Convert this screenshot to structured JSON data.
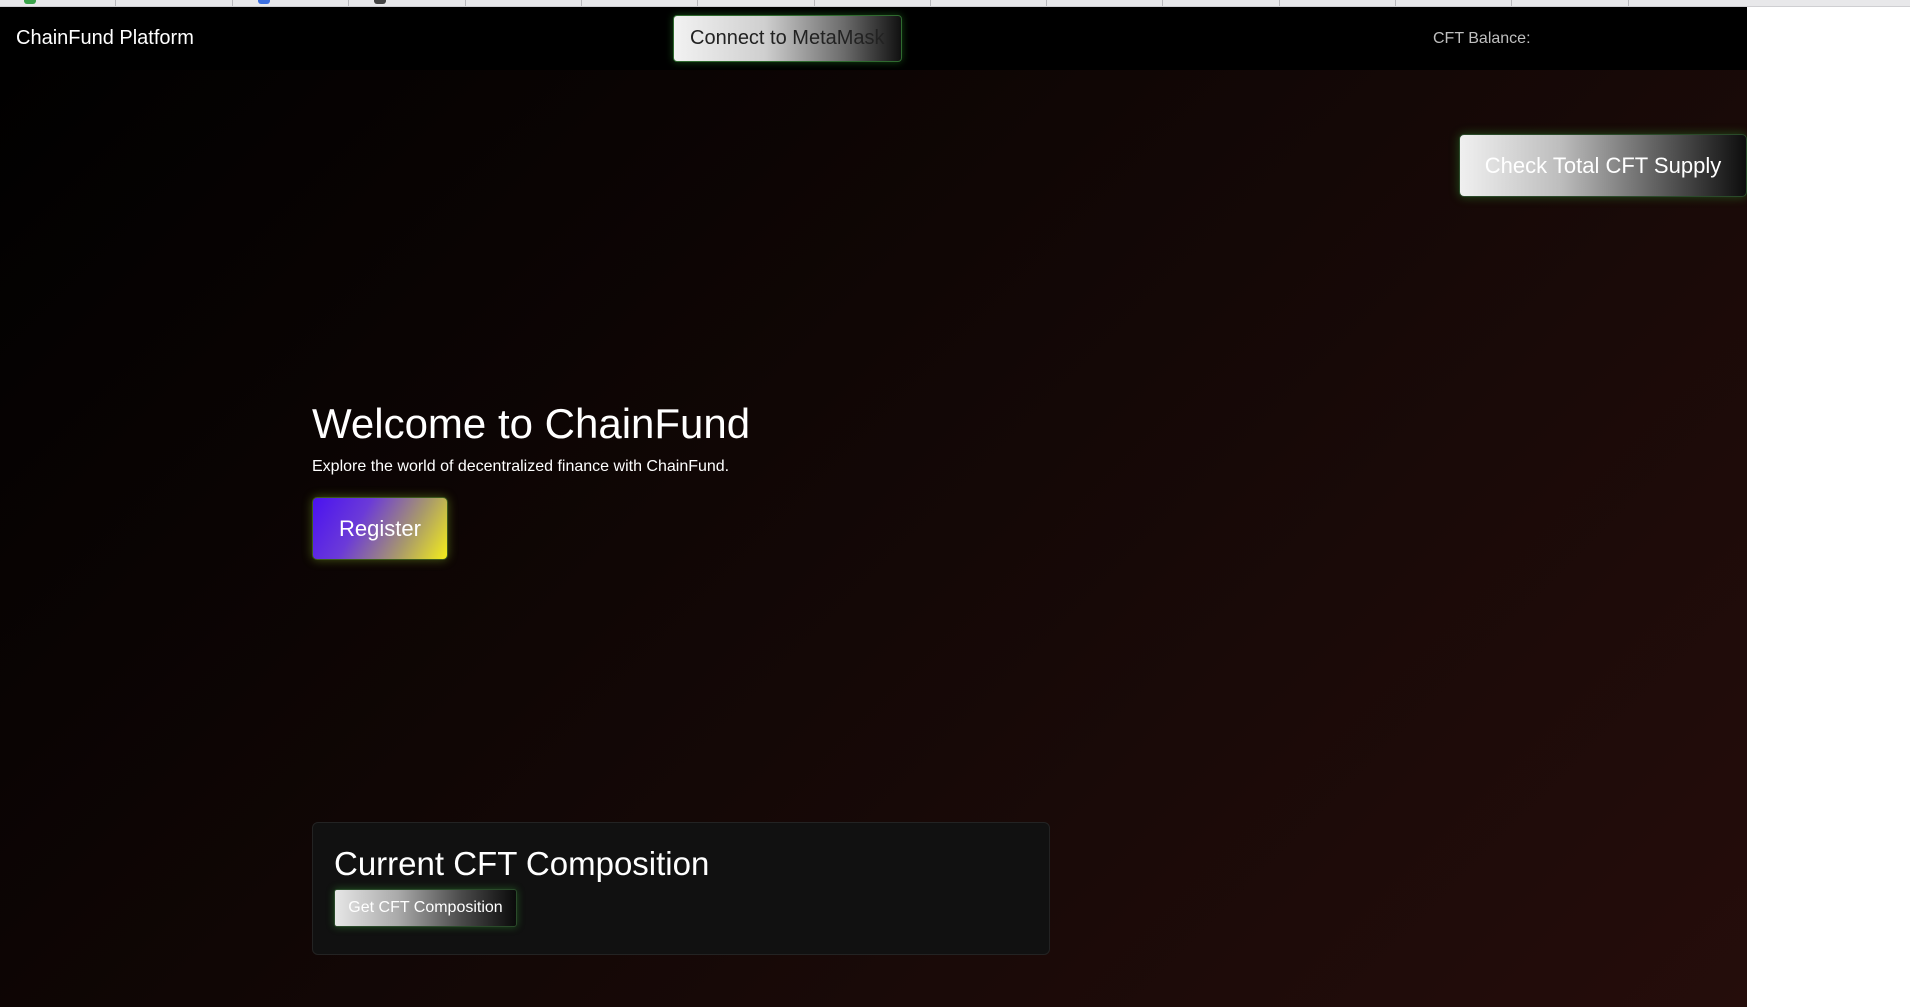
{
  "nav": {
    "brand": "ChainFund Platform",
    "connect_label": "Connect to MetaMask",
    "balance_label": "CFT Balance:"
  },
  "supply": {
    "label": "Check Total CFT Supply"
  },
  "hero": {
    "title": "Welcome to ChainFund",
    "subtitle": "Explore the world of decentralized finance with ChainFund.",
    "register_label": "Register"
  },
  "composition": {
    "title": "Current CFT Composition",
    "button_label": "Get CFT Composition"
  },
  "colors": {
    "background": "#000000",
    "register_gradient_start": "#4a12f0",
    "register_gradient_end": "#f4ee1a",
    "button_glow": "#3cc83c",
    "card_background": "#111111"
  }
}
